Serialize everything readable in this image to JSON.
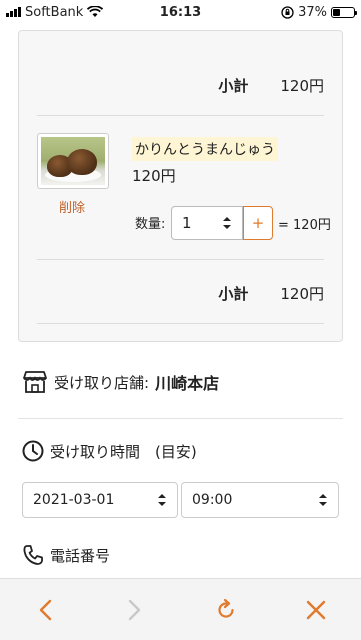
{
  "status_bar": {
    "carrier": "SoftBank",
    "time": "16:13",
    "battery": "37%",
    "battery_level": 0.37
  },
  "cart": {
    "top_subtotal_label": "小計",
    "top_subtotal_value": "120円",
    "item": {
      "name": "かりんとうまんじゅう",
      "price": "120円",
      "delete_label": "削除",
      "qty_label": "数量:",
      "qty_value": "1",
      "plus_label": "+",
      "line_total": "= 120円"
    },
    "bottom_subtotal_label": "小計",
    "bottom_subtotal_value": "120円"
  },
  "pickup": {
    "store_label": "受け取り店舗:",
    "store_value": "川崎本店",
    "time_label": "受け取り時間　(目安)",
    "date_value": "2021-03-01",
    "time_value": "09:00",
    "phone_label": "電話番号"
  },
  "colors": {
    "accent": "#e07a2c"
  }
}
